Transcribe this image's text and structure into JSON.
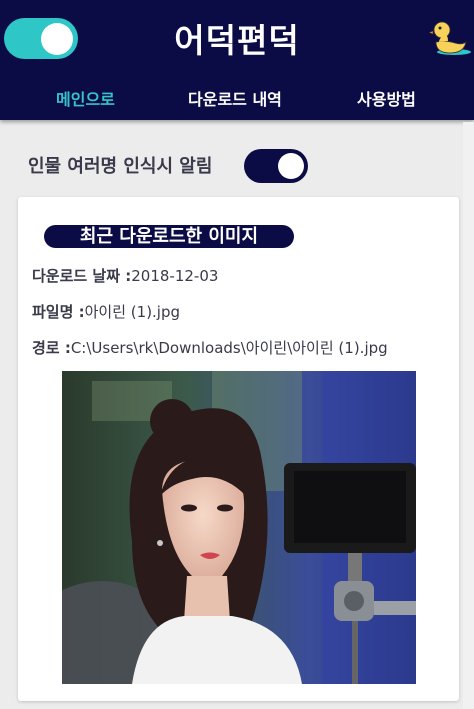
{
  "header": {
    "title": "어덕편덕",
    "nav": [
      {
        "label": "메인으로",
        "active": true
      },
      {
        "label": "다운로드 내역",
        "active": false
      },
      {
        "label": "사용방법",
        "active": false
      }
    ],
    "main_toggle_on": true,
    "logo_icon": "duck-icon"
  },
  "settings": {
    "multi_person_alert_label": "인물 여러명 인식시 알림",
    "multi_person_alert_on": true
  },
  "recent": {
    "title": "최근 다운로드한 이미지",
    "date_label": "다운로드 날짜 :",
    "date_value": "2018-12-03",
    "file_label": "파일명 :",
    "file_value": "아이린 (1).jpg",
    "path_label": "경로 :",
    "path_value": "C:\\Users\\rk\\Downloads\\아이린\\아이린 (1).jpg"
  },
  "colors": {
    "header_bg": "#0b0b45",
    "accent": "#2ec6c7"
  }
}
